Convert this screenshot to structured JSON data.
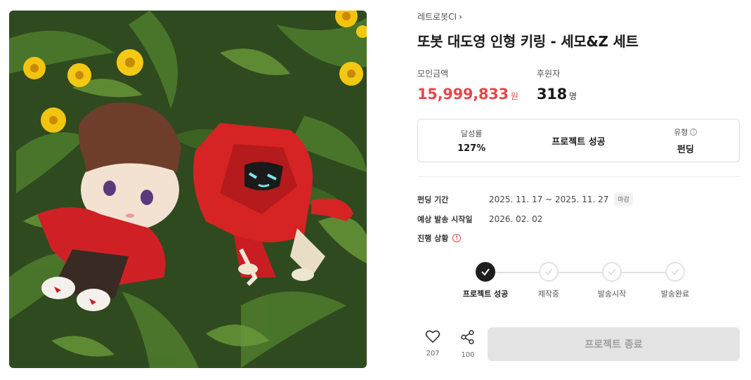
{
  "product": {
    "image_alt": "plush keychains in flowers",
    "creator": "레트로봇CI",
    "title": "또봇 대도영 인형 키링 - 세모&Z 세트"
  },
  "stats": {
    "amount_label": "모인금액",
    "amount": "15,999,833",
    "amount_unit": "원",
    "backers_label": "후원자",
    "backers": "318",
    "backers_unit": "명"
  },
  "summary": {
    "rate_label": "달성률",
    "rate": "127%",
    "status": "프로젝트 성공",
    "type_label": "유형",
    "type": "펀딩"
  },
  "details": {
    "period_label": "펀딩 기간",
    "period": "2025. 11. 17 ~ 2025. 11. 27",
    "period_badge": "마감",
    "ship_label": "예상 발송 시작일",
    "ship_date": "2026. 02. 02",
    "progress_label": "진행 상황"
  },
  "steps": [
    {
      "label": "프로젝트 성공",
      "state": "done"
    },
    {
      "label": "제작중",
      "state": "pending"
    },
    {
      "label": "발송시작",
      "state": "pending"
    },
    {
      "label": "발송완료",
      "state": "pending"
    }
  ],
  "actions": {
    "like_icon": "heart-icon",
    "likes": "207",
    "share_icon": "share-icon",
    "shares": "100",
    "end_label": "프로젝트 종료"
  },
  "colors": {
    "accent": "#e5484d",
    "done": "#1e1e1e",
    "disabled_bg": "#e4e4e4"
  }
}
